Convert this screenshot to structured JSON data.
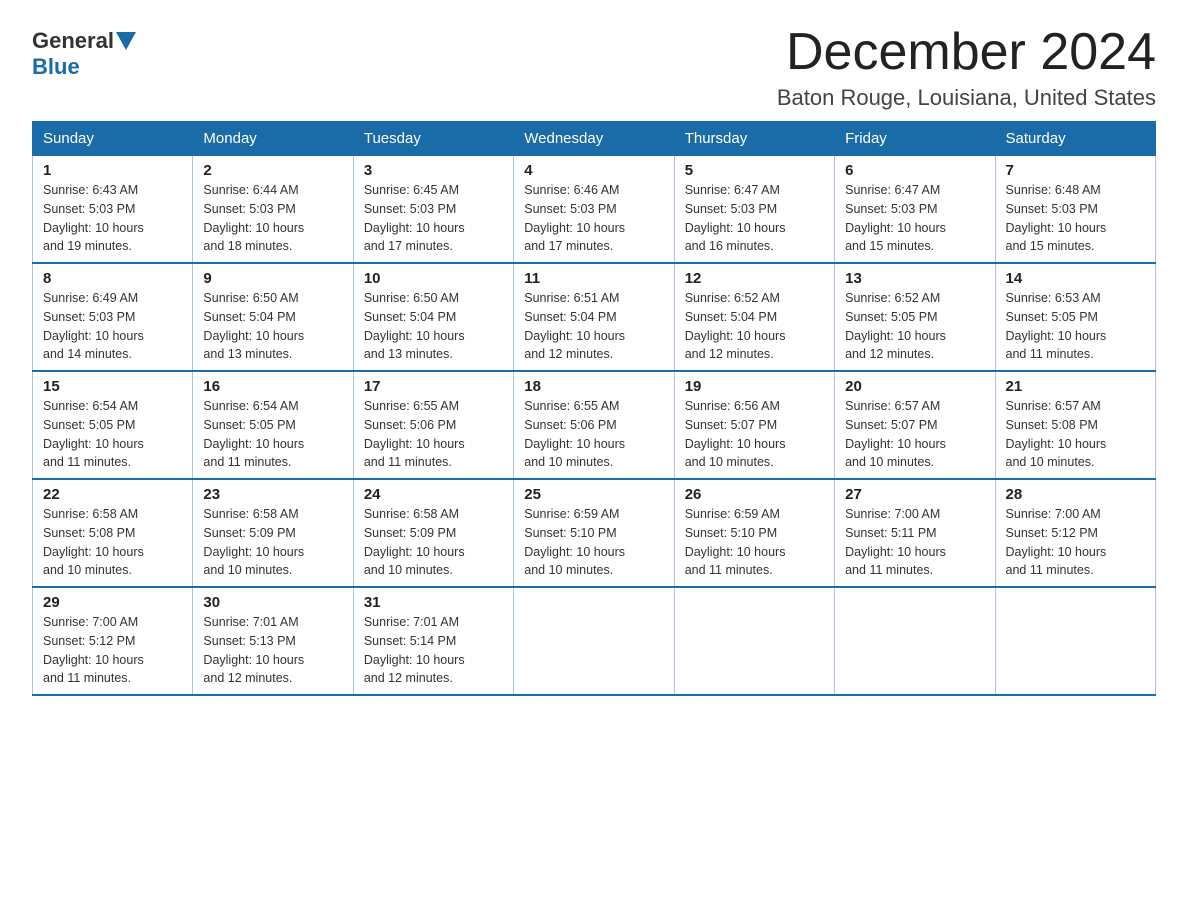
{
  "logo": {
    "general": "General",
    "blue": "Blue"
  },
  "title": {
    "month_year": "December 2024",
    "location": "Baton Rouge, Louisiana, United States"
  },
  "weekdays": [
    "Sunday",
    "Monday",
    "Tuesday",
    "Wednesday",
    "Thursday",
    "Friday",
    "Saturday"
  ],
  "weeks": [
    [
      {
        "day": "1",
        "sunrise": "6:43 AM",
        "sunset": "5:03 PM",
        "daylight": "10 hours and 19 minutes."
      },
      {
        "day": "2",
        "sunrise": "6:44 AM",
        "sunset": "5:03 PM",
        "daylight": "10 hours and 18 minutes."
      },
      {
        "day": "3",
        "sunrise": "6:45 AM",
        "sunset": "5:03 PM",
        "daylight": "10 hours and 17 minutes."
      },
      {
        "day": "4",
        "sunrise": "6:46 AM",
        "sunset": "5:03 PM",
        "daylight": "10 hours and 17 minutes."
      },
      {
        "day": "5",
        "sunrise": "6:47 AM",
        "sunset": "5:03 PM",
        "daylight": "10 hours and 16 minutes."
      },
      {
        "day": "6",
        "sunrise": "6:47 AM",
        "sunset": "5:03 PM",
        "daylight": "10 hours and 15 minutes."
      },
      {
        "day": "7",
        "sunrise": "6:48 AM",
        "sunset": "5:03 PM",
        "daylight": "10 hours and 15 minutes."
      }
    ],
    [
      {
        "day": "8",
        "sunrise": "6:49 AM",
        "sunset": "5:03 PM",
        "daylight": "10 hours and 14 minutes."
      },
      {
        "day": "9",
        "sunrise": "6:50 AM",
        "sunset": "5:04 PM",
        "daylight": "10 hours and 13 minutes."
      },
      {
        "day": "10",
        "sunrise": "6:50 AM",
        "sunset": "5:04 PM",
        "daylight": "10 hours and 13 minutes."
      },
      {
        "day": "11",
        "sunrise": "6:51 AM",
        "sunset": "5:04 PM",
        "daylight": "10 hours and 12 minutes."
      },
      {
        "day": "12",
        "sunrise": "6:52 AM",
        "sunset": "5:04 PM",
        "daylight": "10 hours and 12 minutes."
      },
      {
        "day": "13",
        "sunrise": "6:52 AM",
        "sunset": "5:05 PM",
        "daylight": "10 hours and 12 minutes."
      },
      {
        "day": "14",
        "sunrise": "6:53 AM",
        "sunset": "5:05 PM",
        "daylight": "10 hours and 11 minutes."
      }
    ],
    [
      {
        "day": "15",
        "sunrise": "6:54 AM",
        "sunset": "5:05 PM",
        "daylight": "10 hours and 11 minutes."
      },
      {
        "day": "16",
        "sunrise": "6:54 AM",
        "sunset": "5:05 PM",
        "daylight": "10 hours and 11 minutes."
      },
      {
        "day": "17",
        "sunrise": "6:55 AM",
        "sunset": "5:06 PM",
        "daylight": "10 hours and 11 minutes."
      },
      {
        "day": "18",
        "sunrise": "6:55 AM",
        "sunset": "5:06 PM",
        "daylight": "10 hours and 10 minutes."
      },
      {
        "day": "19",
        "sunrise": "6:56 AM",
        "sunset": "5:07 PM",
        "daylight": "10 hours and 10 minutes."
      },
      {
        "day": "20",
        "sunrise": "6:57 AM",
        "sunset": "5:07 PM",
        "daylight": "10 hours and 10 minutes."
      },
      {
        "day": "21",
        "sunrise": "6:57 AM",
        "sunset": "5:08 PM",
        "daylight": "10 hours and 10 minutes."
      }
    ],
    [
      {
        "day": "22",
        "sunrise": "6:58 AM",
        "sunset": "5:08 PM",
        "daylight": "10 hours and 10 minutes."
      },
      {
        "day": "23",
        "sunrise": "6:58 AM",
        "sunset": "5:09 PM",
        "daylight": "10 hours and 10 minutes."
      },
      {
        "day": "24",
        "sunrise": "6:58 AM",
        "sunset": "5:09 PM",
        "daylight": "10 hours and 10 minutes."
      },
      {
        "day": "25",
        "sunrise": "6:59 AM",
        "sunset": "5:10 PM",
        "daylight": "10 hours and 10 minutes."
      },
      {
        "day": "26",
        "sunrise": "6:59 AM",
        "sunset": "5:10 PM",
        "daylight": "10 hours and 11 minutes."
      },
      {
        "day": "27",
        "sunrise": "7:00 AM",
        "sunset": "5:11 PM",
        "daylight": "10 hours and 11 minutes."
      },
      {
        "day": "28",
        "sunrise": "7:00 AM",
        "sunset": "5:12 PM",
        "daylight": "10 hours and 11 minutes."
      }
    ],
    [
      {
        "day": "29",
        "sunrise": "7:00 AM",
        "sunset": "5:12 PM",
        "daylight": "10 hours and 11 minutes."
      },
      {
        "day": "30",
        "sunrise": "7:01 AM",
        "sunset": "5:13 PM",
        "daylight": "10 hours and 12 minutes."
      },
      {
        "day": "31",
        "sunrise": "7:01 AM",
        "sunset": "5:14 PM",
        "daylight": "10 hours and 12 minutes."
      },
      null,
      null,
      null,
      null
    ]
  ],
  "labels": {
    "sunrise": "Sunrise:",
    "sunset": "Sunset:",
    "daylight": "Daylight:"
  }
}
